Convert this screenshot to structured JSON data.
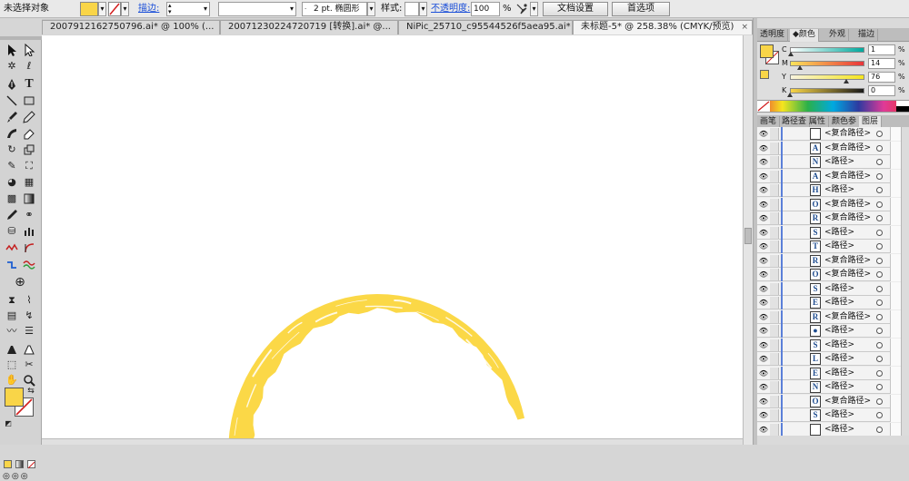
{
  "control_bar": {
    "selection_status": "未选择对象",
    "stroke_label": "描边:",
    "brush_size": "2 pt. 椭圆形",
    "style_label": "样式:",
    "opacity_label": "不透明度:",
    "opacity_value": "100",
    "opacity_unit": "%",
    "doc_setup_button": "文档设置",
    "preferences_button": "首选项"
  },
  "tabs": [
    {
      "label": "20079121627507​96.ai* @ 100% (..."
    },
    {
      "label": "20071230224720719 [转换].ai* @..."
    },
    {
      "label": "NiPic_25710_c95544526f5aea95.ai*"
    },
    {
      "label": "未标题-5* @ 258.38% (CMYK/预览)",
      "close": "×"
    }
  ],
  "color_panel": {
    "tabs": [
      "透明度",
      "颜色",
      "外观",
      "描边"
    ],
    "active_tab": "颜色",
    "fill_color": "#f9d548",
    "channels": [
      {
        "label": "C",
        "value": "1",
        "unit": "%",
        "from": "#ffffff",
        "to": "#00a99d",
        "level": 0.01
      },
      {
        "label": "M",
        "value": "14",
        "unit": "%",
        "from": "#fbe35a",
        "to": "#e8343a",
        "level": 0.14
      },
      {
        "label": "Y",
        "value": "76",
        "unit": "%",
        "from": "#f9f4de",
        "to": "#f5e51f",
        "level": 0.76
      },
      {
        "label": "K",
        "value": "0",
        "unit": "%",
        "from": "#f9d548",
        "to": "#1a1a1a",
        "level": 0.0
      }
    ]
  },
  "layers_panel": {
    "tabs": [
      "画笔",
      "路径查",
      "属性",
      "颜色参",
      "图层"
    ],
    "active_tab": "图层",
    "rows": [
      {
        "glyph": "",
        "name": "<复合路径>"
      },
      {
        "glyph": "A",
        "name": "<复合路径>"
      },
      {
        "glyph": "N",
        "name": "<路径>"
      },
      {
        "glyph": "A",
        "name": "<复合路径>"
      },
      {
        "glyph": "H",
        "name": "<路径>"
      },
      {
        "glyph": "O",
        "name": "<复合路径>"
      },
      {
        "glyph": "R",
        "name": "<复合路径>"
      },
      {
        "glyph": "S",
        "name": "<路径>"
      },
      {
        "glyph": "T",
        "name": "<路径>"
      },
      {
        "glyph": "R",
        "name": "<复合路径>"
      },
      {
        "glyph": "O",
        "name": "<复合路径>"
      },
      {
        "glyph": "S",
        "name": "<路径>"
      },
      {
        "glyph": "E",
        "name": "<路径>"
      },
      {
        "glyph": "R",
        "name": "<复合路径>"
      },
      {
        "glyph": "●",
        "name": "<路径>"
      },
      {
        "glyph": "S",
        "name": "<路径>"
      },
      {
        "glyph": "L",
        "name": "<路径>"
      },
      {
        "glyph": "E",
        "name": "<路径>"
      },
      {
        "glyph": "N",
        "name": "<路径>"
      },
      {
        "glyph": "O",
        "name": "<复合路径>"
      },
      {
        "glyph": "S",
        "name": "<路径>"
      },
      {
        "glyph": "",
        "name": "<路径>"
      }
    ]
  },
  "colors": {
    "accent": "#1b4fd8",
    "brush": "#fbd847",
    "stroke_none": "#d21e1e"
  }
}
